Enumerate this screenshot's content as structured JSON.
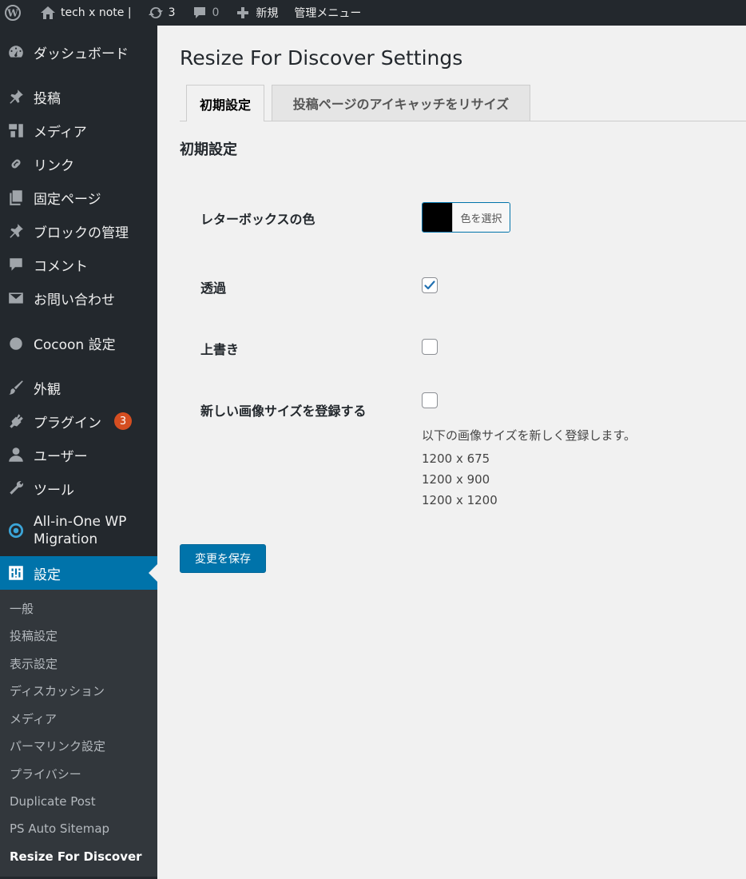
{
  "adminbar": {
    "site_name": "tech x note |",
    "updates_count": "3",
    "comments_count": "0",
    "new_label": "新規",
    "admin_menu_label": "管理メニュー"
  },
  "sidebar": {
    "items": [
      {
        "label": "ダッシュボード",
        "icon": "dashboard-icon"
      },
      {
        "label": "投稿",
        "icon": "pin-icon"
      },
      {
        "label": "メディア",
        "icon": "media-icon"
      },
      {
        "label": "リンク",
        "icon": "link-icon"
      },
      {
        "label": "固定ページ",
        "icon": "page-icon"
      },
      {
        "label": "ブロックの管理",
        "icon": "pin-icon"
      },
      {
        "label": "コメント",
        "icon": "comment-icon"
      },
      {
        "label": "お問い合わせ",
        "icon": "mail-icon"
      },
      {
        "label": "Cocoon 設定",
        "icon": "circle-icon"
      },
      {
        "label": "外観",
        "icon": "brush-icon"
      },
      {
        "label": "プラグイン",
        "icon": "plugin-icon",
        "badge": "3"
      },
      {
        "label": "ユーザー",
        "icon": "user-icon"
      },
      {
        "label": "ツール",
        "icon": "wrench-icon"
      },
      {
        "label_line1": "All-in-One WP",
        "label_line2": "Migration",
        "icon": "migration-icon"
      },
      {
        "label": "設定",
        "icon": "settings-icon"
      }
    ],
    "submenu": [
      "一般",
      "投稿設定",
      "表示設定",
      "ディスカッション",
      "メディア",
      "パーマリンク設定",
      "プライバシー",
      "Duplicate Post",
      "PS Auto Sitemap",
      "Resize For Discover"
    ]
  },
  "main": {
    "title": "Resize For Discover Settings",
    "tabs": [
      {
        "label": "初期設定",
        "active": true
      },
      {
        "label": "投稿ページのアイキャッチをリサイズ",
        "active": false
      }
    ],
    "section_title": "初期設定",
    "fields": {
      "letterbox_color_label": "レターボックスの色",
      "color_button_label": "色を選択",
      "color_value": "#000000",
      "transparency_label": "透過",
      "transparency_checked": true,
      "overwrite_label": "上書き",
      "overwrite_checked": false,
      "register_sizes_label": "新しい画像サイズを登録する",
      "register_sizes_checked": false,
      "register_desc": "以下の画像サイズを新しく登録します。",
      "sizes": [
        "1200 x 675",
        "1200 x 900",
        "1200 x 1200"
      ]
    },
    "save_label": "変更を保存"
  },
  "colors": {
    "admin_dark": "#23282d",
    "submenu_bg": "#32373c",
    "accent": "#0073aa",
    "badge": "#d54e21",
    "page_bg": "#f1f1f1"
  }
}
